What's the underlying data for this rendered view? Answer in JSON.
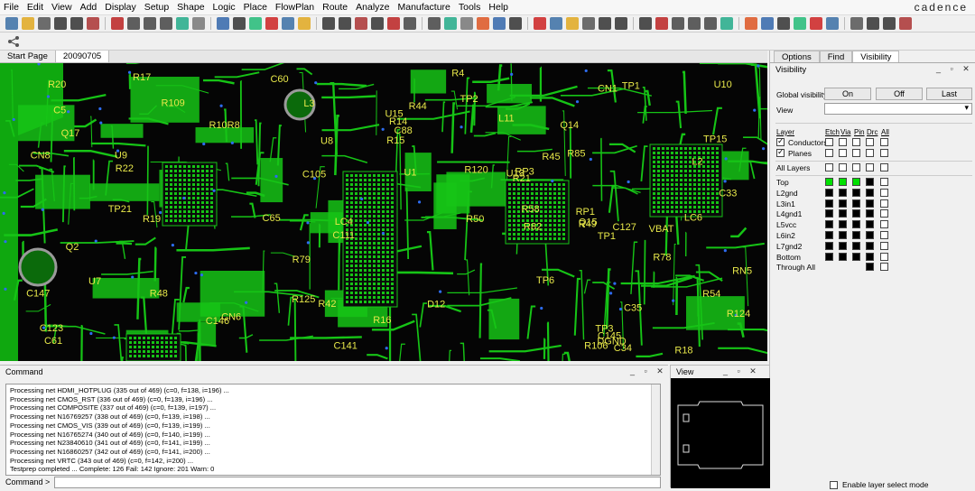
{
  "menu": [
    "File",
    "Edit",
    "View",
    "Add",
    "Display",
    "Setup",
    "Shape",
    "Logic",
    "Place",
    "FlowPlan",
    "Route",
    "Analyze",
    "Manufacture",
    "Tools",
    "Help"
  ],
  "brand": "cadence",
  "toolbar": {
    "icons": [
      "open-icon",
      "save-icon",
      "delete-icon",
      "undo-icon",
      "redo-icon",
      "pin-icon",
      "move-icon",
      "add-connect-icon",
      "zoom-in-icon",
      "zoom-out-icon",
      "zoom-fit-icon",
      "refresh-icon",
      "grid-icon",
      "color-icon",
      "3d-view-icon",
      "visibility-icon",
      "layers-icon",
      "drc-icon"
    ]
  },
  "tabs": [
    "Start Page",
    "20090705"
  ],
  "canvas_labels": [
    "R79",
    "TP1",
    "R85",
    "CN8",
    "RN5",
    "RP3",
    "U1",
    "TP3",
    "TP6",
    "R10R8",
    "R4",
    "R48",
    "R44",
    "R45",
    "R42",
    "R58",
    "U15",
    "Q14",
    "Q2",
    "CN6",
    "C88",
    "R124",
    "R125",
    "Q17",
    "Q15",
    "U9",
    "R82",
    "R106",
    "R78",
    "R49",
    "C65",
    "TP15",
    "R50",
    "RP1",
    "U13",
    "D12",
    "U8",
    "C105",
    "R54",
    "TP2",
    "C111",
    "U7",
    "R21",
    "R22",
    "C60",
    "C33",
    "C34",
    "C61",
    "TP1",
    "C35",
    "R16",
    "R14",
    "R15",
    "C5",
    "LC4",
    "R19",
    "R20",
    "R18",
    "R17",
    "C145",
    "C146",
    "CN1",
    "L11",
    "C127",
    "C141",
    "U10",
    "L2",
    "L3",
    "C123",
    "LC6",
    "C147",
    "R109",
    "TP21",
    "R120",
    "DGND",
    "VBAT"
  ],
  "right_panel": {
    "tabs": [
      "Options",
      "Find",
      "Visibility"
    ],
    "title": "Visibility",
    "global_visibility_label": "Global visibility",
    "buttons": [
      "On",
      "Off",
      "Last"
    ],
    "view_label": "View",
    "view_value": "",
    "layer_header": "Layer",
    "columns": [
      "Etch",
      "Via",
      "Pin",
      "Drc",
      "All"
    ],
    "categories": [
      {
        "label": "Conductors",
        "checked": true
      },
      {
        "label": "Planes",
        "checked": true
      }
    ],
    "all_layers_label": "All Layers",
    "layers": [
      {
        "name": "Top",
        "colors": [
          "green",
          "green",
          "green",
          "black",
          "empty"
        ]
      },
      {
        "name": "L2gnd",
        "colors": [
          "black",
          "black",
          "black",
          "black",
          "empty"
        ]
      },
      {
        "name": "L3in1",
        "colors": [
          "black",
          "black",
          "black",
          "black",
          "empty"
        ]
      },
      {
        "name": "L4gnd1",
        "colors": [
          "black",
          "black",
          "black",
          "black",
          "empty"
        ]
      },
      {
        "name": "L5vcc",
        "colors": [
          "black",
          "black",
          "black",
          "black",
          "empty"
        ]
      },
      {
        "name": "L6in2",
        "colors": [
          "black",
          "black",
          "black",
          "black",
          "empty"
        ]
      },
      {
        "name": "L7gnd2",
        "colors": [
          "black",
          "black",
          "black",
          "black",
          "empty"
        ]
      },
      {
        "name": "Bottom",
        "colors": [
          "black",
          "black",
          "black",
          "black",
          "empty"
        ]
      },
      {
        "name": "Through All",
        "colors": [
          "none",
          "none",
          "none",
          "black",
          "empty"
        ]
      }
    ],
    "enable_layer_select": "Enable layer select mode"
  },
  "command": {
    "title": "Command",
    "log": [
      "Processing net HDMI_HOTPLUG (335 out of 469) (c=0, f=138, i=196) ...",
      "Processing net CMOS_RST (336 out of 469) (c=0, f=139, i=196) ...",
      "Processing net COMPOSITE (337 out of 469) (c=0, f=139, i=197) ...",
      "Processing net N16769257 (338 out of 469) (c=0, f=139, i=198) ...",
      "Processing net CMOS_VIS (339 out of 469) (c=0, f=139, i=199) ...",
      "Processing net N16765274 (340 out of 469) (c=0, f=140, i=199) ...",
      "Processing net N23840610 (341 out of 469) (c=0, f=141, i=199) ...",
      "Processing net N16860257 (342 out of 469) (c=0, f=141, i=200) ...",
      "Processing net VRTC (343 out of 469) (c=0, f=142, i=200) ...",
      "Testprep completed ... Complete: 126 Fail: 142 Ignore: 201 Warn: 0"
    ],
    "prompt": "Command >",
    "input_value": ""
  },
  "view_panel": {
    "title": "View"
  },
  "colors": {
    "board_green": "#0fa80f",
    "copper": "#16c416",
    "silk": "#e8e84a",
    "via": "#2d6cf0",
    "background": "#050505"
  }
}
